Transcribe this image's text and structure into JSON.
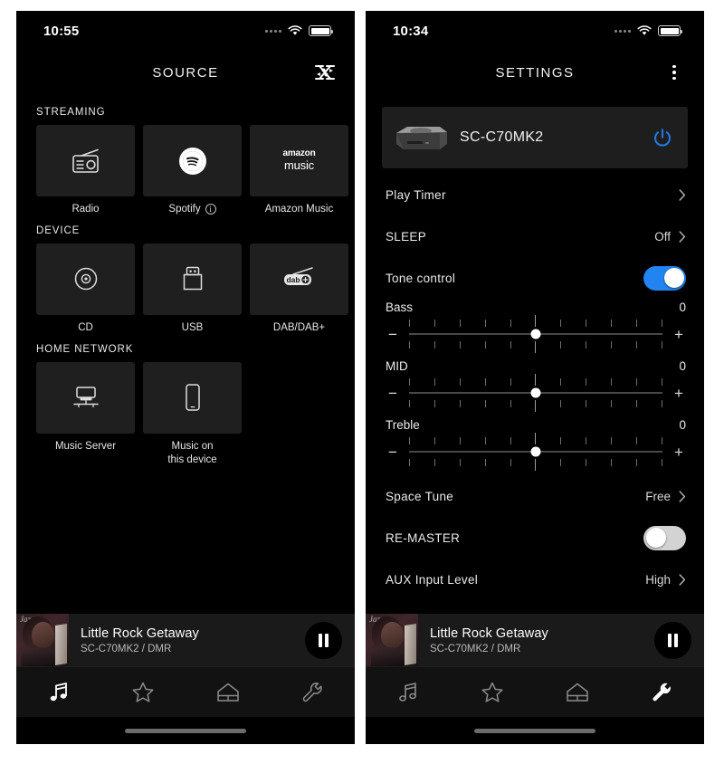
{
  "app": {
    "accent_blue": "#2184f0",
    "bg": "#000000",
    "card_bg": "#1f1f1f"
  },
  "left_panel": {
    "status": {
      "time": "10:55",
      "wifi": "wifi-icon",
      "battery": "battery-icon"
    },
    "header": {
      "title": "SOURCE",
      "action_icon": "multiroom-link-icon"
    },
    "sections": [
      {
        "heading": "STREAMING",
        "tiles": [
          {
            "label": "Radio",
            "icon": "radio-icon",
            "info": false
          },
          {
            "label": "Spotify",
            "icon": "spotify-icon",
            "info": true,
            "info_glyph": "i"
          },
          {
            "label": "Amazon Music",
            "icon": "amazon-music-icon",
            "info": false,
            "logo_line1": "amazon",
            "logo_line2": "music"
          },
          {
            "label": "",
            "icon": "partial-tile",
            "info": false
          }
        ]
      },
      {
        "heading": "DEVICE",
        "tiles": [
          {
            "label": "CD",
            "icon": "cd-disc-icon",
            "info": false
          },
          {
            "label": "USB",
            "icon": "usb-icon",
            "info": false
          },
          {
            "label": "DAB/DAB+",
            "icon": "dab-radio-icon",
            "info": false
          },
          {
            "label": "",
            "icon": "partial-tile",
            "info": false
          }
        ]
      },
      {
        "heading": "HOME NETWORK",
        "tiles": [
          {
            "label": "Music Server",
            "icon": "music-server-icon",
            "info": false
          },
          {
            "label": "Music on\nthis device",
            "label_line1": "Music on",
            "label_line2": "this device",
            "icon": "phone-icon",
            "info": false
          }
        ]
      }
    ],
    "now_playing": {
      "title": "Little Rock Getaway",
      "subtitle": "SC-C70MK2 / DMR",
      "button_icon": "pause-icon"
    },
    "tabs": [
      {
        "name": "music",
        "icon": "music-note-icon",
        "active": true
      },
      {
        "name": "favorites",
        "icon": "star-icon",
        "active": false
      },
      {
        "name": "rooms",
        "icon": "house-icon",
        "active": false
      },
      {
        "name": "settings",
        "icon": "wrench-icon",
        "active": false
      }
    ]
  },
  "right_panel": {
    "status": {
      "time": "10:34",
      "wifi": "wifi-icon",
      "battery": "battery-icon"
    },
    "header": {
      "title": "SETTINGS",
      "action_icon": "kebab-menu-icon"
    },
    "device": {
      "name": "SC-C70MK2",
      "image": "compact-stereo-icon",
      "power_icon": "power-icon"
    },
    "rows": [
      {
        "type": "nav",
        "label": "Play Timer",
        "value": "",
        "chevron": true
      },
      {
        "type": "nav",
        "label": "SLEEP",
        "value": "Off",
        "chevron": true
      },
      {
        "type": "toggle",
        "label": "Tone control",
        "on": true
      },
      {
        "type": "slider",
        "label": "Bass",
        "value": "0",
        "minus": "−",
        "plus": "+",
        "position_pct": 50,
        "ticks": 11
      },
      {
        "type": "slider",
        "label": "MID",
        "value": "0",
        "minus": "−",
        "plus": "+",
        "position_pct": 50,
        "ticks": 11
      },
      {
        "type": "slider",
        "label": "Treble",
        "value": "0",
        "minus": "−",
        "plus": "+",
        "position_pct": 50,
        "ticks": 11
      },
      {
        "type": "nav",
        "label": "Space Tune",
        "value": "Free",
        "chevron": true
      },
      {
        "type": "toggle",
        "label": "RE-MASTER",
        "on": false
      },
      {
        "type": "nav",
        "label": "AUX Input Level",
        "value": "High",
        "chevron": true
      }
    ],
    "now_playing": {
      "title": "Little Rock Getaway",
      "subtitle": "SC-C70MK2 / DMR",
      "button_icon": "pause-icon"
    },
    "tabs": [
      {
        "name": "music",
        "icon": "music-note-icon",
        "active": false
      },
      {
        "name": "favorites",
        "icon": "star-icon",
        "active": false
      },
      {
        "name": "rooms",
        "icon": "house-icon",
        "active": false
      },
      {
        "name": "settings",
        "icon": "wrench-icon",
        "active": true
      }
    ]
  }
}
